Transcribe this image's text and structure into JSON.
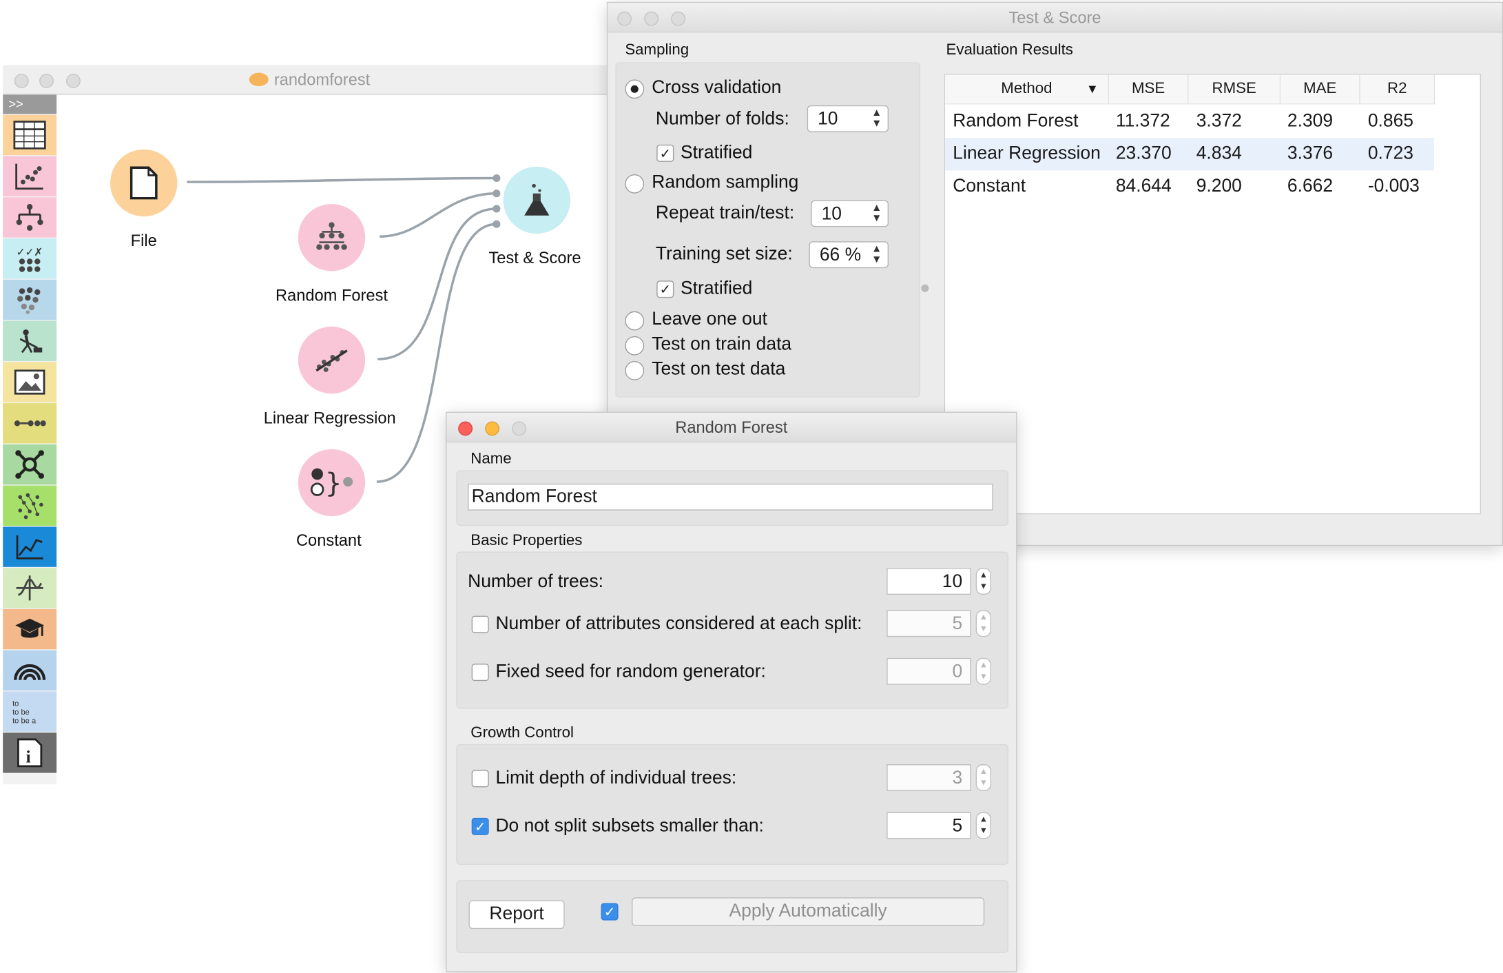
{
  "canvas": {
    "title": "randomforest",
    "toolbox_collapse": ">>",
    "toolbox_icons": [
      "table-icon",
      "scatter-icon",
      "tree-icon",
      "matrix-icon",
      "cluster-icon",
      "dig-icon",
      "image-icon",
      "sequence-icon",
      "network-icon",
      "scatter-map-icon",
      "line-chart-icon",
      "spectra-icon",
      "education-icon",
      "rainbow-icon",
      "text-icon",
      "info-icon"
    ],
    "toolbox_text_item": "to\nto be\nto be a",
    "nodes": {
      "file": "File",
      "random_forest": "Random Forest",
      "linear_regression": "Linear Regression",
      "constant": "Constant",
      "test_score": "Test & Score"
    }
  },
  "test_score": {
    "title": "Test & Score",
    "sampling_label": "Sampling",
    "eval_label": "Evaluation Results",
    "cross_validation": "Cross validation",
    "num_folds_label": "Number of folds:",
    "num_folds": "10",
    "stratified1": "Stratified",
    "random_sampling": "Random sampling",
    "repeat_label": "Repeat train/test:",
    "repeat": "10",
    "train_size_label": "Training set size:",
    "train_size": "66 %",
    "stratified2": "Stratified",
    "leave_one_out": "Leave one out",
    "test_train": "Test on train data",
    "test_test": "Test on test data",
    "selected_method": "Cross validation",
    "table": {
      "headers": [
        "Method",
        "MSE",
        "RMSE",
        "MAE",
        "R2"
      ],
      "sort_indicator": "▼",
      "rows": [
        [
          "Random Forest",
          "11.372",
          "3.372",
          "2.309",
          "0.865"
        ],
        [
          "Linear Regression",
          "23.370",
          "4.834",
          "3.376",
          "0.723"
        ],
        [
          "Constant",
          "84.644",
          "9.200",
          "6.662",
          "-0.003"
        ]
      ],
      "highlighted_row": 1
    }
  },
  "random_forest": {
    "title": "Random Forest",
    "name_label": "Name",
    "name_value": "Random Forest",
    "basic_label": "Basic Properties",
    "num_trees_label": "Number of trees:",
    "num_trees": "10",
    "num_attrs_label": "Number of attributes considered at each split:",
    "num_attrs": "5",
    "fixed_seed_label": "Fixed seed for random generator:",
    "fixed_seed": "0",
    "growth_label": "Growth Control",
    "limit_depth_label": "Limit depth of individual trees:",
    "limit_depth": "3",
    "min_split_label": "Do not split subsets smaller than:",
    "min_split": "5",
    "report_label": "Report",
    "apply_label": "Apply Automatically",
    "checkmark": "✓"
  },
  "colors": {
    "traffic_red": "#fc605b",
    "traffic_yellow": "#fdbc40",
    "checkbox_blue": "#3b8eea",
    "file_node": "#fcd29a",
    "learner_node": "#f9c6d8",
    "evaluate_node": "#c7eef2",
    "highlight_row": "#e8f0fc"
  }
}
